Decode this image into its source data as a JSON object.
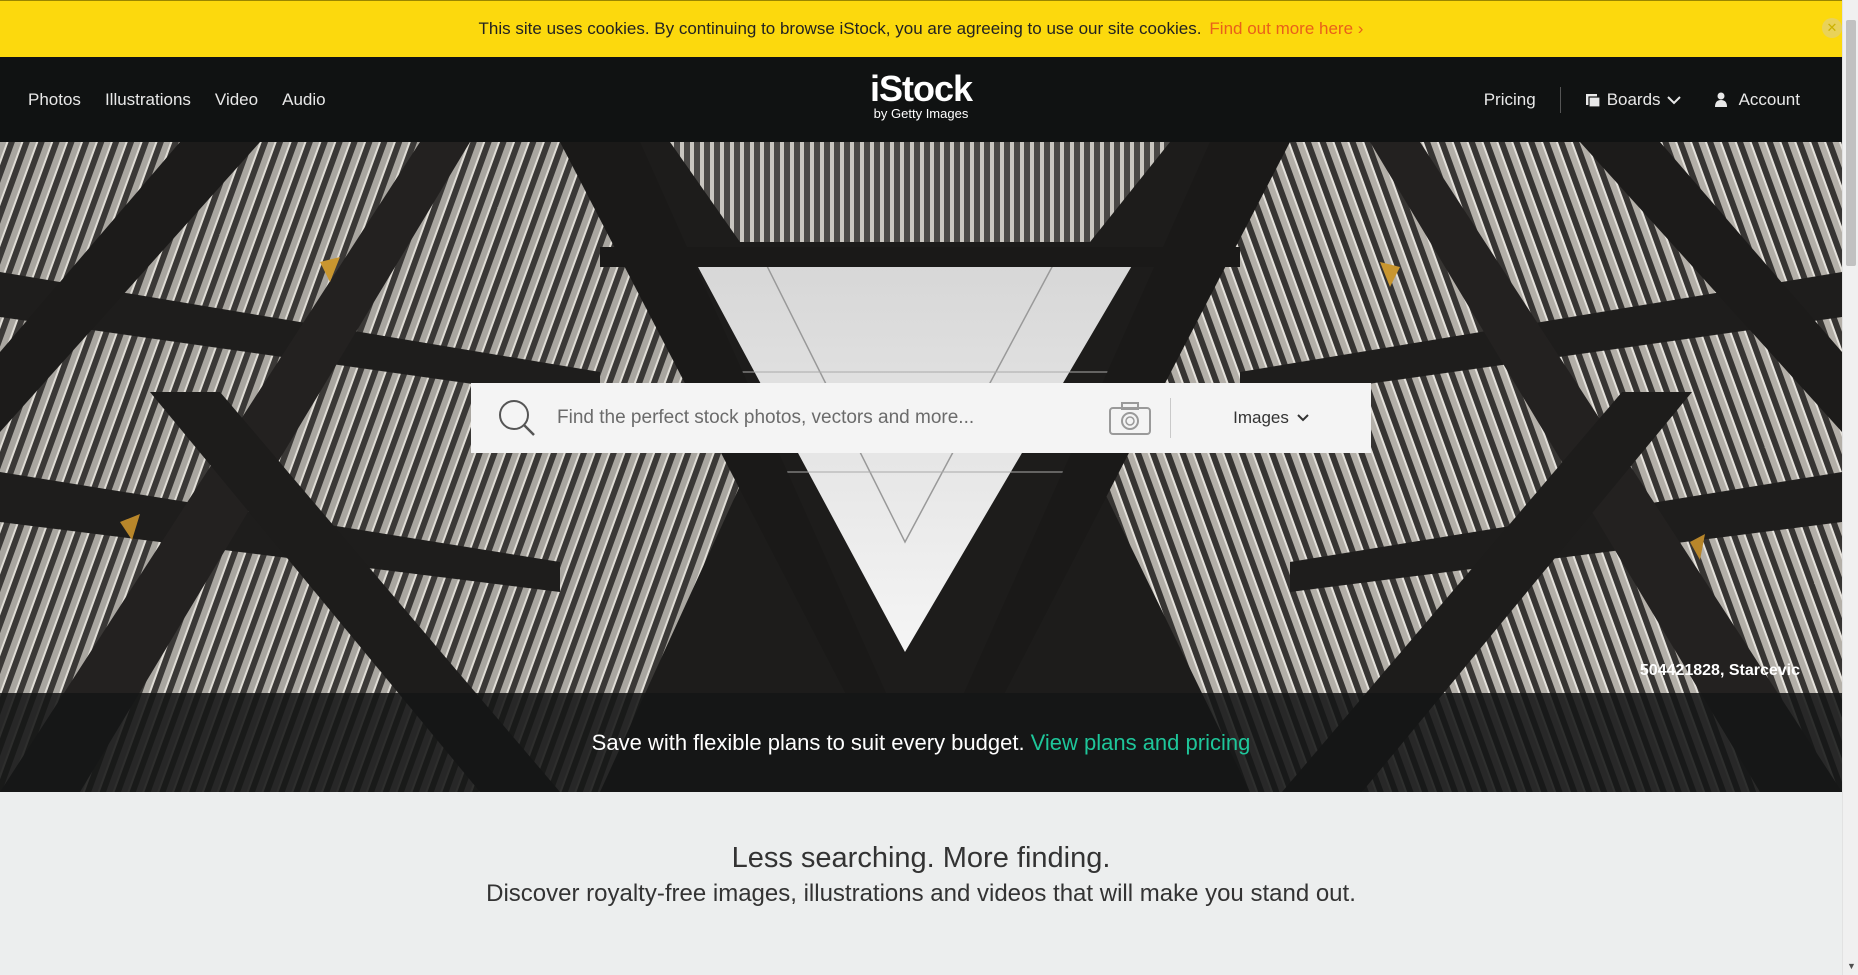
{
  "cookie_bar": {
    "message": "This site uses cookies. By continuing to browse iStock, you are agreeing to use our site cookies.",
    "link_label": "Find out more here ›",
    "close_icon": "close-icon"
  },
  "nav": {
    "left_items": [
      {
        "label": "Photos"
      },
      {
        "label": "Illustrations"
      },
      {
        "label": "Video"
      },
      {
        "label": "Audio"
      }
    ],
    "logo": {
      "main": "iStock",
      "sub": "by Getty Images"
    },
    "pricing_label": "Pricing",
    "boards_label": "Boards",
    "account_label": "Account"
  },
  "search": {
    "placeholder": "Find the perfect stock photos, vectors and more...",
    "media_type": "Images"
  },
  "hero": {
    "credit": "504421828, Starcevic"
  },
  "promo": {
    "text": "Save with flexible plans to suit every budget.",
    "link_label": "View plans and pricing"
  },
  "tagline": {
    "heading": "Less searching. More finding.",
    "subheading": "Discover royalty-free images, illustrations and videos that will make you stand out."
  },
  "colors": {
    "cookie_bar": "#fcd90d",
    "cookie_link": "#e9601a",
    "nav_bg": "#101212",
    "promo_link": "#1ec69a",
    "page_bg": "#eceeee"
  }
}
